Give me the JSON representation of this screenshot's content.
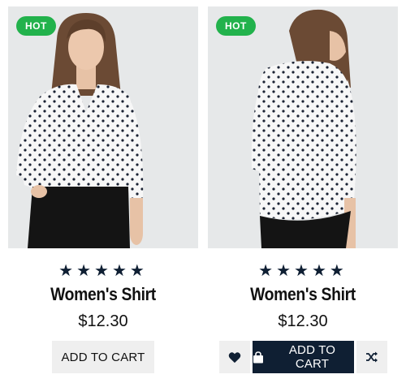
{
  "products": [
    {
      "badge": "HOT",
      "rating": "★★★★★",
      "name": "Women's Shirt",
      "price": "$12.30",
      "cart_label": "ADD TO CART",
      "photo": "front-view-woman-polka-dot-blouse"
    },
    {
      "badge": "HOT",
      "rating": "★★★★★",
      "name": "Women's Shirt",
      "price": "$12.30",
      "cart_label": "ADD TO CART",
      "photo": "back-view-woman-polka-dot-blouse"
    }
  ],
  "colors": {
    "badge": "#22b24c",
    "accent_dark": "#0f1f33",
    "button_light": "#efefef"
  },
  "icons": {
    "wishlist": "heart-icon",
    "cart": "shopping-bag-icon",
    "compare": "shuffle-icon"
  }
}
